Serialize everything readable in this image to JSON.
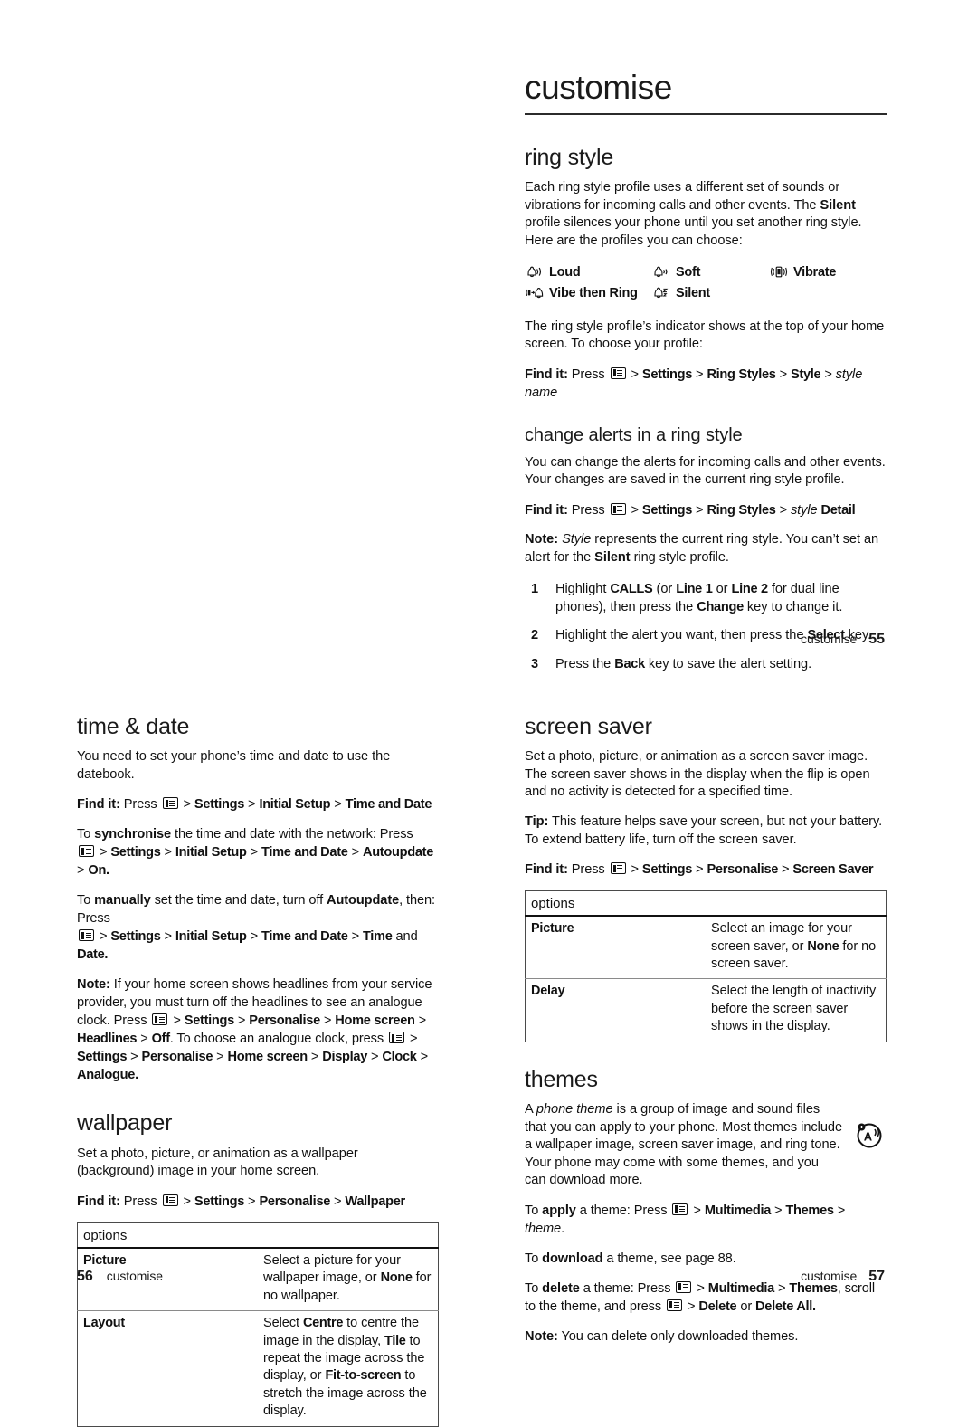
{
  "document": {
    "title": "customise"
  },
  "pages": [
    {
      "number": "55",
      "footer_label": "customise"
    },
    {
      "number": "56",
      "footer_label": "customise"
    },
    {
      "number": "57",
      "footer_label": "customise"
    }
  ],
  "ring_style": {
    "heading": "ring style",
    "intro_1": "Each ring style profile uses a different set of sounds or vibrations for incoming calls and other events. The ",
    "intro_silent": "Silent",
    "intro_2": " profile silences your phone until you set another ring style. Here are the profiles you can choose:",
    "profiles": [
      {
        "icon": "bell-loud-icon",
        "label": "Loud"
      },
      {
        "icon": "bell-soft-icon",
        "label": "Soft"
      },
      {
        "icon": "vibrate-icon",
        "label": "Vibrate"
      },
      {
        "icon": "vibe-then-ring-icon",
        "label": "Vibe then Ring"
      },
      {
        "icon": "bell-silent-icon",
        "label": "Silent"
      }
    ],
    "indicator_text": "The ring style profile’s indicator shows at the top of your home screen. To choose your profile:",
    "findit": {
      "prefix": "Find it:",
      "press": "Press",
      "key_icon": "menu-key-icon",
      "path": [
        "Settings",
        "Ring Styles",
        "Style"
      ],
      "italic_tail": "style name"
    }
  },
  "change_alerts": {
    "heading": "change alerts in a ring style",
    "intro": "You can change the alerts for incoming calls and other events. Your changes are saved in the current ring style profile.",
    "findit": {
      "prefix": "Find it:",
      "press": "Press",
      "key_icon": "menu-key-icon",
      "path": [
        "Settings",
        "Ring Styles"
      ],
      "italic_tail": "style",
      "bold_tail": "Detail"
    },
    "note_label": "Note:",
    "note_italic": "Style",
    "note_1": " represents the current ring style. You can’t set an alert for the ",
    "note_bold": "Silent",
    "note_2": " ring style profile.",
    "steps": [
      {
        "number": "1",
        "parts": [
          {
            "t": "Highlight ",
            "s": "n"
          },
          {
            "t": "CALLS",
            "s": "b"
          },
          {
            "t": " (or ",
            "s": "n"
          },
          {
            "t": "Line 1",
            "s": "b"
          },
          {
            "t": " or ",
            "s": "n"
          },
          {
            "t": "Line 2",
            "s": "b"
          },
          {
            "t": " for dual line phones), then press the ",
            "s": "n"
          },
          {
            "t": "Change",
            "s": "b"
          },
          {
            "t": " key to change it.",
            "s": "n"
          }
        ]
      },
      {
        "number": "2",
        "parts": [
          {
            "t": "Highlight the alert you want, then press the ",
            "s": "n"
          },
          {
            "t": "Select",
            "s": "b"
          },
          {
            "t": " key.",
            "s": "n"
          }
        ]
      },
      {
        "number": "3",
        "parts": [
          {
            "t": "Press the ",
            "s": "n"
          },
          {
            "t": "Back",
            "s": "b"
          },
          {
            "t": " key to save the alert setting.",
            "s": "n"
          }
        ]
      }
    ]
  },
  "time_date": {
    "heading": "time & date",
    "intro": "You need to set your phone’s time and date to use the datebook.",
    "findit": {
      "prefix": "Find it:",
      "press": "Press",
      "key_icon": "menu-key-icon",
      "path": [
        "Settings",
        "Initial Setup",
        "Time and Date"
      ]
    },
    "sync_lead": "To ",
    "sync_bold": "synchronise",
    "sync_rest": " the time and date with the network: Press",
    "sync_path": [
      "Settings",
      "Initial Setup",
      "Time and Date",
      "Autoupdate",
      "On."
    ],
    "manual_lead": "To ",
    "manual_bold": "manually",
    "manual_mid": " set the time and date, turn off ",
    "manual_bold2": "Autoupdate",
    "manual_rest": ", then: Press",
    "manual_path": [
      "Settings",
      "Initial Setup",
      "Time and Date",
      "Time"
    ],
    "manual_path_and": "and",
    "manual_path_last": "Date.",
    "note_label": "Note:",
    "note_text": " If your home screen shows headlines from your service provider, you must turn off the headlines to see an analogue clock. Press ",
    "note_path_1": [
      "Settings",
      "Personalise",
      "Home screen",
      "Headlines"
    ],
    "note_off": "Off",
    "note_mid": ". To choose an analogue clock, press ",
    "note_path_2": [
      "Settings"
    ],
    "note_path_3": [
      "Personalise",
      "Home screen",
      "Display",
      "Clock",
      "Analogue."
    ]
  },
  "wallpaper": {
    "heading": "wallpaper",
    "intro": "Set a photo, picture, or animation as a wallpaper (background) image in your home screen.",
    "findit": {
      "prefix": "Find it:",
      "press": "Press",
      "key_icon": "menu-key-icon",
      "path": [
        "Settings",
        "Personalise",
        "Wallpaper"
      ]
    },
    "table": {
      "header": "options",
      "rows": [
        {
          "key": "Picture",
          "parts": [
            {
              "t": "Select a picture for your wallpaper image, or ",
              "s": "n"
            },
            {
              "t": "None",
              "s": "b"
            },
            {
              "t": " for no wallpaper.",
              "s": "n"
            }
          ]
        },
        {
          "key": "Layout",
          "parts": [
            {
              "t": "Select ",
              "s": "n"
            },
            {
              "t": "Centre",
              "s": "b"
            },
            {
              "t": " to centre the image in the display, ",
              "s": "n"
            },
            {
              "t": "Tile",
              "s": "b"
            },
            {
              "t": " to repeat the image across the display, or ",
              "s": "n"
            },
            {
              "t": "Fit-to-screen",
              "s": "b"
            },
            {
              "t": " to stretch the image across the display.",
              "s": "n"
            }
          ]
        }
      ]
    }
  },
  "screen_saver": {
    "heading": "screen saver",
    "intro": "Set a photo, picture, or animation as a screen saver image. The screen saver shows in the display when the flip is open and no activity is detected for a specified time.",
    "tip_label": "Tip:",
    "tip_text": " This feature helps save your screen, but not your battery. To extend battery life, turn off the screen saver.",
    "findit": {
      "prefix": "Find it:",
      "press": "Press",
      "key_icon": "menu-key-icon",
      "path": [
        "Settings",
        "Personalise",
        "Screen Saver"
      ]
    },
    "table": {
      "header": "options",
      "rows": [
        {
          "key": "Picture",
          "parts": [
            {
              "t": "Select an image for your screen saver, or ",
              "s": "n"
            },
            {
              "t": "None",
              "s": "b"
            },
            {
              "t": " for no screen saver.",
              "s": "n"
            }
          ]
        },
        {
          "key": "Delay",
          "parts": [
            {
              "t": "Select the length of inactivity before the screen saver shows in the display.",
              "s": "n"
            }
          ]
        }
      ]
    }
  },
  "themes": {
    "heading": "themes",
    "icon": "theme-style-icon",
    "intro_parts": [
      {
        "t": "A ",
        "s": "n"
      },
      {
        "t": "phone theme",
        "s": "i"
      },
      {
        "t": " is a group of image and sound files that you can apply to your phone. Most themes include a wallpaper image, screen saver image, and ring tone. Your phone may come with some themes, and you can download more.",
        "s": "n"
      }
    ],
    "apply_lead": "To ",
    "apply_bold": "apply",
    "apply_mid": " a theme: Press",
    "apply_path": [
      "Multimedia",
      "Themes"
    ],
    "apply_italic": "theme",
    "apply_period": ".",
    "download_lead": "To ",
    "download_bold": "download",
    "download_rest": " a theme, see page 88.",
    "delete_lead": "To ",
    "delete_bold": "delete",
    "delete_mid": " a theme: Press",
    "delete_path": [
      "Multimedia",
      "Themes"
    ],
    "delete_rest": ", scroll to the theme, and press",
    "delete_opt1": "Delete",
    "delete_or": " or ",
    "delete_opt2": "Delete All.",
    "note_label": "Note:",
    "note_text": " You can delete only downloaded themes."
  }
}
